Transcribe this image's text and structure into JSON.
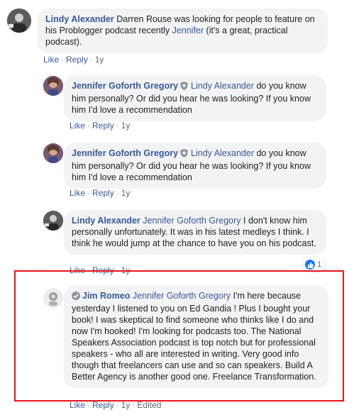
{
  "comments": [
    {
      "author": "Lindy Alexander",
      "mention_pre": "",
      "text": " Darren Rouse was looking for people to feature on his Problogger podcast recently ",
      "mention_inline": "Jennifer",
      "text_after": " (it's a great, practical podcast).",
      "actions": {
        "like": "Like",
        "reply": "Reply",
        "time": "1y"
      }
    },
    {
      "author": "Jennifer Goforth Gregory",
      "mention": "Lindy Alexander",
      "text": " do you know him personally? Or did you hear he was looking? If you know him I'd love a recommendation",
      "actions": {
        "like": "Like",
        "reply": "Reply",
        "time": "1y"
      }
    },
    {
      "author": "Jennifer Goforth Gregory",
      "mention": "Lindy Alexander",
      "text": " do you know him personally? Or did you hear he was looking? If you know him I'd love a recommendation",
      "actions": {
        "like": "Like",
        "reply": "Reply",
        "time": "1y"
      }
    },
    {
      "author": "Lindy Alexander",
      "mention": "Jennifer Goforth Gregory",
      "text": " I don't know him personally unfortunately. It was in his latest medleys I think. I think he would jump at the chance to have you on his podcast.",
      "reaction_count": "1",
      "actions": {
        "like": "Like",
        "reply": "Reply",
        "time": "1y"
      }
    },
    {
      "author": "Jim Romeo",
      "mention": "Jennifer Goforth Gregory",
      "text": " I'm here because yesterday I listened to you on Ed Gandia ! Plus I bought your book! I was skeptical to find someone who thinks like I do and now I'm hooked! I'm looking for podcasts too. The National Speakers Association podcast is top notch but for professional speakers - who all are interested in writing. Very good info though that freelancers can use and so can speakers. Build A Better Agency is another good one. Freelance Transformation.",
      "actions": {
        "like": "Like",
        "reply": "Reply",
        "time": "1y",
        "edited": "Edited"
      }
    }
  ],
  "colors": {
    "link": "#385898",
    "bubble": "#f2f3f5",
    "highlight": "#e8131b",
    "like_blue": "#1877f2"
  },
  "icons": {
    "badge": "shield-badge-icon",
    "verified": "check-badge-icon",
    "reaction": "thumbs-up-icon"
  }
}
